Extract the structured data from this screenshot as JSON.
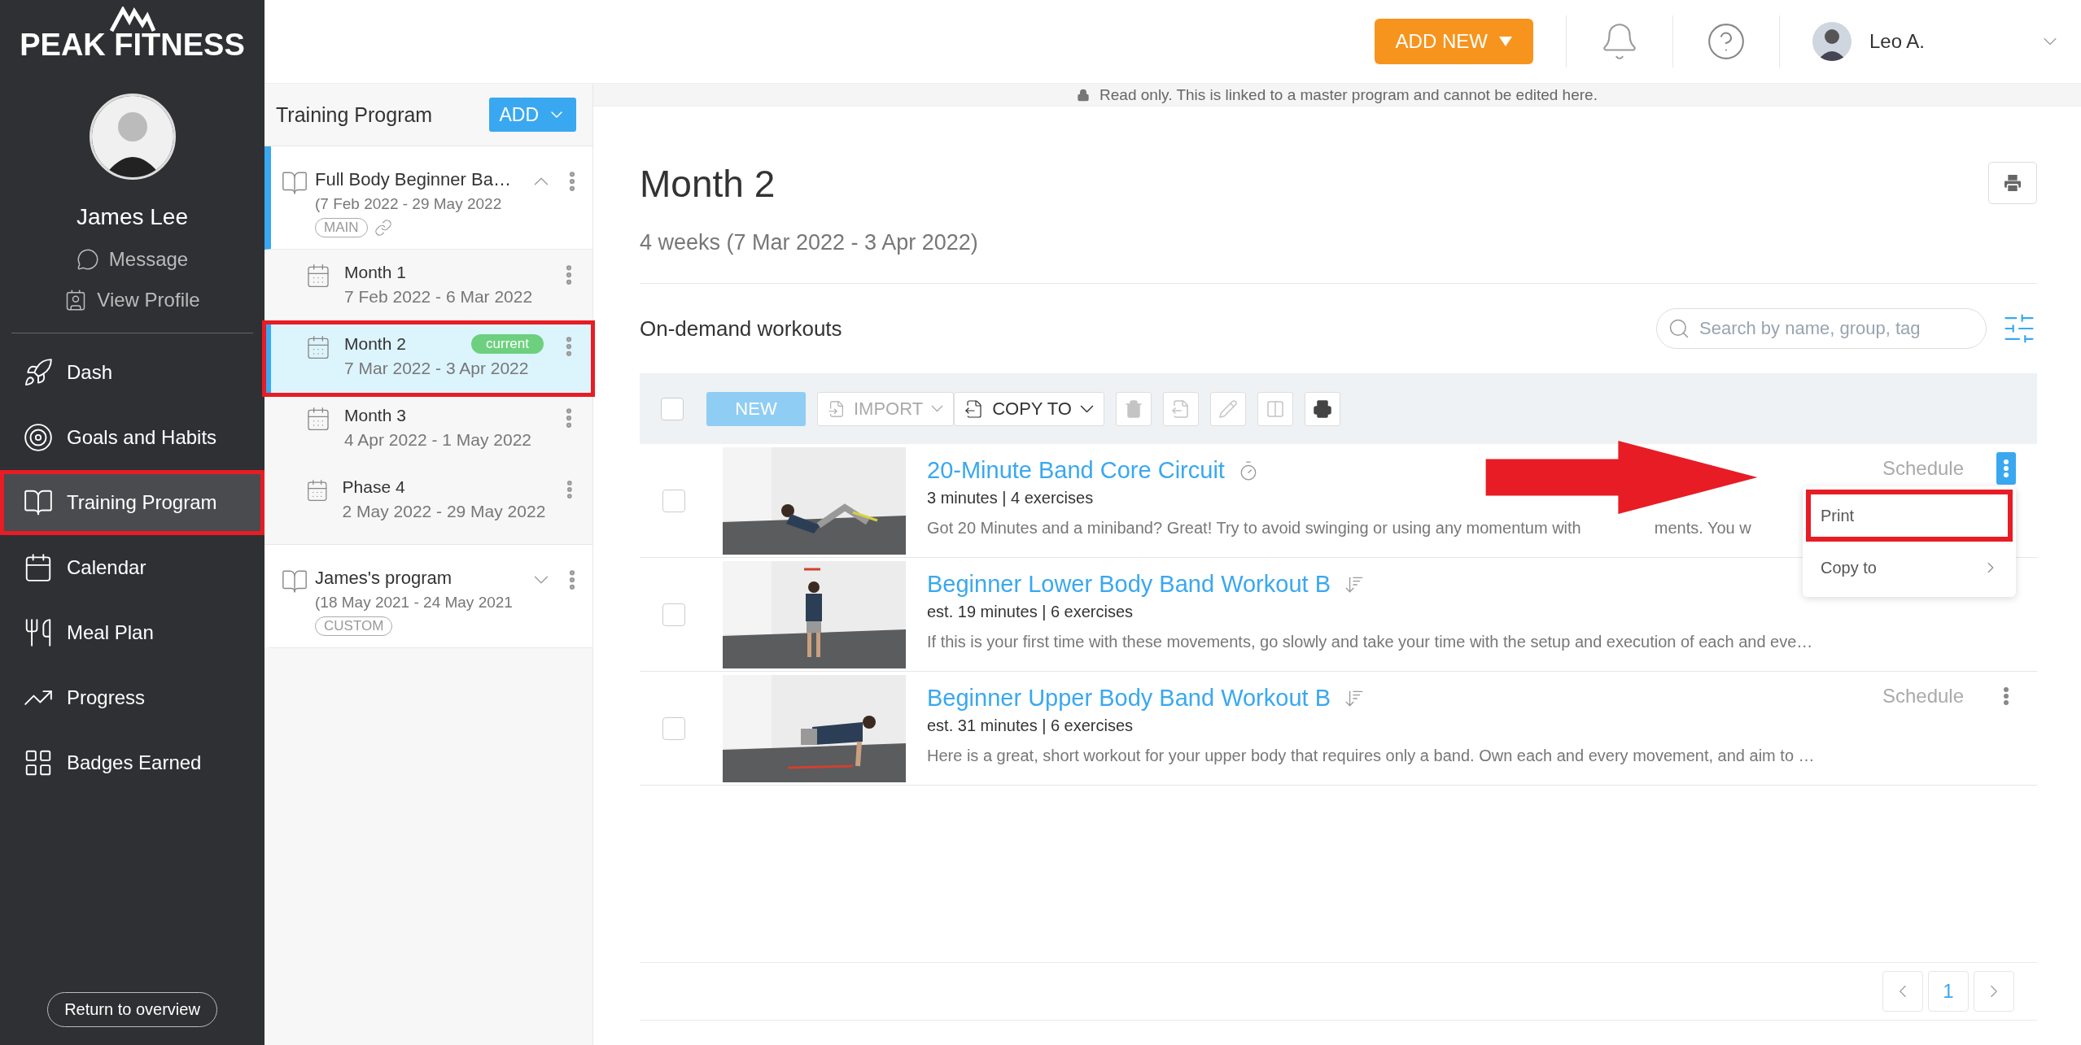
{
  "brand": {
    "name": "PEAK FITNESS"
  },
  "profile": {
    "name": "James Lee",
    "links": [
      {
        "label": "Message",
        "kind": "message"
      },
      {
        "label": "View Profile",
        "kind": "profile"
      }
    ]
  },
  "nav": [
    {
      "label": "Dash",
      "kind": "rocket",
      "selected": false,
      "highlighted": false
    },
    {
      "label": "Goals and Habits",
      "kind": "goals",
      "selected": false,
      "highlighted": false
    },
    {
      "label": "Training Program",
      "kind": "program",
      "selected": true,
      "highlighted": true
    },
    {
      "label": "Calendar",
      "kind": "calendar",
      "selected": false,
      "highlighted": false
    },
    {
      "label": "Meal Plan",
      "kind": "meal",
      "selected": false,
      "highlighted": false
    },
    {
      "label": "Progress",
      "kind": "progress",
      "selected": false,
      "highlighted": false
    },
    {
      "label": "Badges Earned",
      "kind": "badges",
      "selected": false,
      "highlighted": false
    }
  ],
  "return_button": "Return to overview",
  "programs_panel": {
    "title": "Training Program",
    "add_button": "ADD",
    "programs": [
      {
        "name": "Full Body Beginner Ba…",
        "dates": "(7 Feb 2022 - 29 May 2022",
        "tag": "MAIN",
        "linked": true,
        "expanded": true,
        "selected": true,
        "children": [
          {
            "name": "Month 1",
            "dates": "7 Feb 2022 - 6 Mar 2022",
            "selected": false,
            "highlighted": false
          },
          {
            "name": "Month 2",
            "dates": "7 Mar 2022 - 3 Apr 2022",
            "badge": "current",
            "selected": true,
            "highlighted": true
          },
          {
            "name": "Month 3",
            "dates": "4 Apr 2022 - 1 May 2022",
            "selected": false,
            "highlighted": false
          },
          {
            "name": "Phase 4",
            "dates": "2 May 2022 - 29 May 2022",
            "selected": false,
            "highlighted": false
          }
        ]
      },
      {
        "name": "James's program",
        "dates": "(18 May 2021 - 24 May 2021",
        "tag": "CUSTOM",
        "linked": false,
        "expanded": false,
        "selected": false
      }
    ]
  },
  "topbar": {
    "add_new": "ADD NEW",
    "user": "Leo A."
  },
  "notice": "Read only. This is linked to a master program and cannot be edited here.",
  "phase": {
    "title": "Month 2",
    "subtitle": "4 weeks (7 Mar 2022 - 3 Apr 2022)"
  },
  "workouts_section": {
    "title": "On-demand workouts",
    "search_placeholder": "Search by name, group, tag"
  },
  "toolbar": {
    "select_all_checked": false,
    "new_button": "NEW",
    "import": {
      "label": "IMPORT",
      "disabled": true
    },
    "copy_to": {
      "label": "COPY TO",
      "disabled": false
    },
    "icon_buttons": [
      {
        "kind": "trash",
        "disabled": true
      },
      {
        "kind": "export",
        "disabled": true
      },
      {
        "kind": "edit",
        "disabled": true
      },
      {
        "kind": "split",
        "disabled": true
      },
      {
        "kind": "print",
        "disabled": false
      }
    ]
  },
  "workouts": [
    {
      "title": "20-Minute Band Core Circuit",
      "kind": "timed",
      "meta": "3 minutes | 4 exercises",
      "description": "Got 20 Minutes and a miniband? Great! Try to avoid swinging or using any momentum with",
      "description_after": "ments. You w",
      "schedule": "Schedule",
      "checked": false,
      "menu_open": true
    },
    {
      "title": "Beginner Lower Body Band Workout B",
      "kind": "list",
      "meta": "est. 19 minutes | 6 exercises",
      "description": "If this is your first time with these movements, go slowly and take your time with the setup and execution of each and eve…",
      "checked": false
    },
    {
      "title": "Beginner Upper Body Band Workout B",
      "kind": "list",
      "meta": "est. 31 minutes | 6 exercises",
      "description": "Here is a great, short workout for your upper body that requires only a band. Own each and every movement, and aim to …",
      "schedule": "Schedule",
      "checked": false,
      "menu_open": false
    }
  ],
  "row_menu": {
    "items": [
      {
        "label": "Print",
        "highlighted": true,
        "submenu": false,
        "arrow": true
      },
      {
        "label": "Copy to",
        "highlighted": false,
        "submenu": true,
        "arrow": false
      }
    ]
  },
  "pagination": {
    "pages": [
      {
        "label": "1",
        "selected": true
      }
    ]
  }
}
